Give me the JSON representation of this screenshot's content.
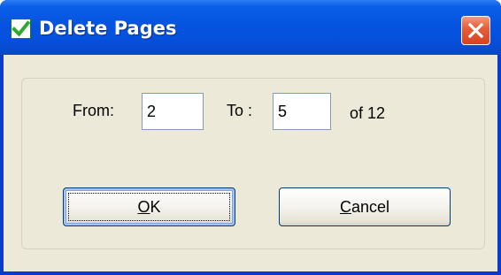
{
  "window": {
    "title": "Delete Pages",
    "icon": "checkmark-icon",
    "close_icon": "close-x-icon"
  },
  "range": {
    "from_label": "From:",
    "from_value": "2",
    "to_label": "To :",
    "to_value": "5",
    "of_text": "of 12"
  },
  "buttons": {
    "ok_mnemonic": "O",
    "ok_rest": "K",
    "cancel_mnemonic": "C",
    "cancel_rest": "ancel"
  },
  "colors": {
    "titlebar_blue": "#0553e0",
    "close_red": "#d8411f",
    "dialog_bg": "#ece9d8",
    "check_green": "#2fa82f"
  }
}
